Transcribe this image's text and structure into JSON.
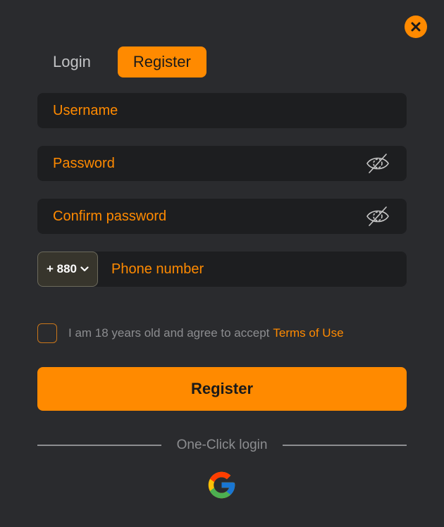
{
  "close": {
    "icon": "close-icon"
  },
  "tabs": [
    {
      "label": "Login",
      "active": false
    },
    {
      "label": "Register",
      "active": true
    }
  ],
  "form": {
    "username": {
      "placeholder": "Username",
      "value": ""
    },
    "password": {
      "placeholder": "Password",
      "value": "",
      "toggle_icon": "eye-slash-icon"
    },
    "confirm_password": {
      "placeholder": "Confirm password",
      "value": "",
      "toggle_icon": "eye-slash-icon"
    },
    "phone": {
      "country_code": "+ 880",
      "placeholder": "Phone number",
      "value": ""
    }
  },
  "terms": {
    "checked": false,
    "text": "I am 18 years old and agree to accept",
    "link": "Terms of Use"
  },
  "submit_label": "Register",
  "divider_label": "One-Click login",
  "social": [
    {
      "icon": "google-icon"
    }
  ],
  "colors": {
    "background": "#2a2b2e",
    "input_background": "#1d1e20",
    "accent": "#ff8a00",
    "muted_text": "#8c8d90"
  }
}
